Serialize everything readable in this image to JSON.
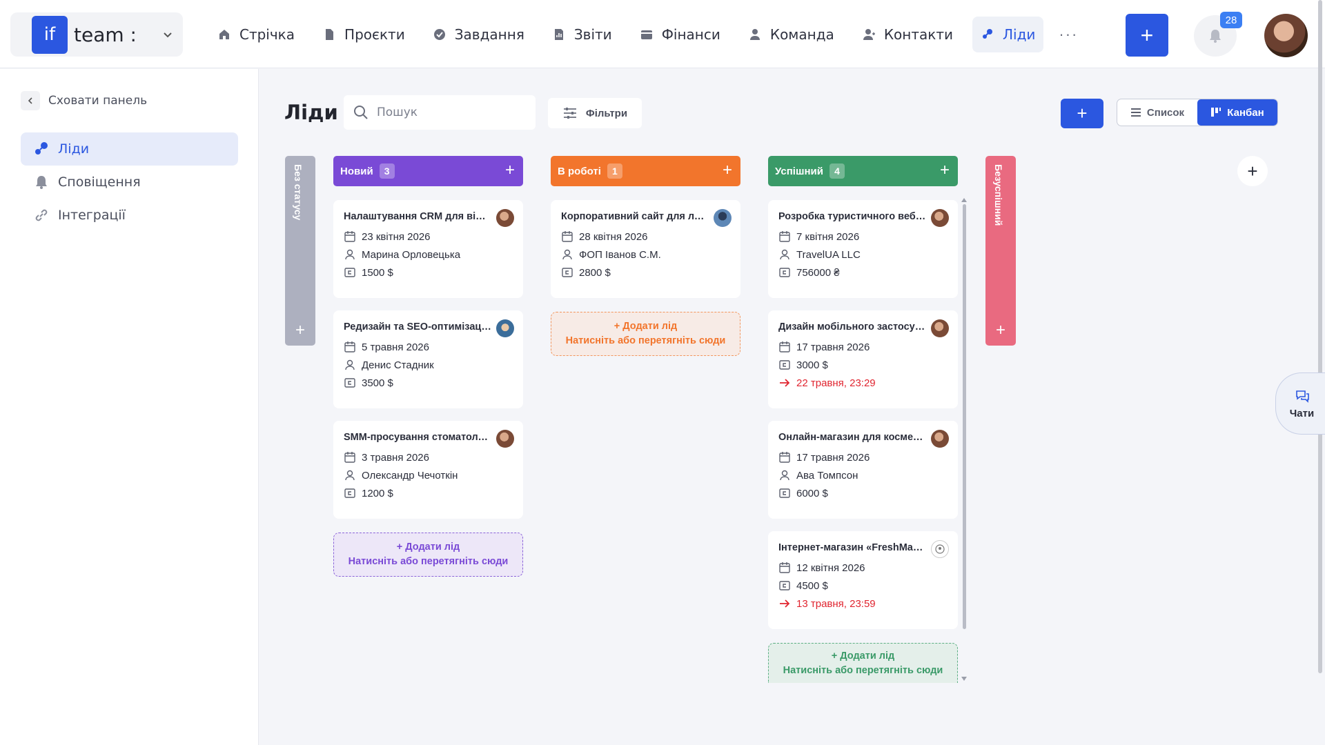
{
  "workspace": {
    "logo": "if",
    "name": "team :"
  },
  "nav": [
    {
      "label": "Стрічка",
      "icon": "home-icon"
    },
    {
      "label": "Проєкти",
      "icon": "document-icon"
    },
    {
      "label": "Завдання",
      "icon": "check-circle-icon"
    },
    {
      "label": "Звіти",
      "icon": "report-icon"
    },
    {
      "label": "Фінанси",
      "icon": "wallet-icon"
    },
    {
      "label": "Команда",
      "icon": "user-icon"
    },
    {
      "label": "Контакти",
      "icon": "contacts-icon"
    },
    {
      "label": "Ліди",
      "icon": "leads-icon"
    }
  ],
  "nav_more": "···",
  "header": {
    "add_label": "+",
    "notifications_count": "28"
  },
  "sidebar": {
    "hide_label": "Сховати панель",
    "items": [
      {
        "label": "Ліди",
        "icon": "leads-icon"
      },
      {
        "label": "Сповіщення",
        "icon": "bell-icon"
      },
      {
        "label": "Інтеграції",
        "icon": "link-icon"
      }
    ]
  },
  "main": {
    "title": "Ліди",
    "search_placeholder": "Пошук",
    "filters_label": "Фільтри",
    "add_label": "+",
    "view_list": "Список",
    "view_kanban": "Канбан"
  },
  "columns": {
    "no_status": {
      "label": "Без статусу",
      "plus": "+",
      "color": "#adb0bf"
    },
    "new": {
      "label": "Новий",
      "count": "3",
      "plus": "+",
      "color": "#7a4ad6"
    },
    "in_progress": {
      "label": "В роботі",
      "count": "1",
      "plus": "+",
      "color": "#f2752c"
    },
    "success": {
      "label": "Успішний",
      "count": "4",
      "plus": "+",
      "color": "#3a9a68"
    },
    "failed": {
      "label": "Безуспішний",
      "plus": "+",
      "color": "#e96a80"
    }
  },
  "cards": {
    "new": [
      {
        "title": "Налаштування CRM для відділу продажів",
        "date": "23 квітня 2026",
        "contact": "Марина Орловецька",
        "amount": "1500 $"
      },
      {
        "title": "Редизайн та SEO-оптимізація сайту",
        "date": "5 травня 2026",
        "contact": "Денис Стадник",
        "amount": "3500 $"
      },
      {
        "title": "SMM-просування стоматологічної клініки",
        "date": "3 травня 2026",
        "contact": "Олександр Чечоткін",
        "amount": "1200 $"
      }
    ],
    "in_progress": [
      {
        "title": "Корпоративний сайт для логістичної компанії",
        "date": "28 квітня 2026",
        "contact": "ФОП Іванов С.М.",
        "amount": "2800 $"
      }
    ],
    "success": [
      {
        "title": "Розробка туристичного веб-порталу",
        "date": "7 квітня 2026",
        "contact": "TravelUA LLC",
        "amount": "756000 ₴"
      },
      {
        "title": "Дизайн мобільного застосунку",
        "date": "17 травня 2026",
        "amount": "3000 $",
        "deadline": "22 травня, 23:29"
      },
      {
        "title": "Онлайн-магазин для косметики",
        "date": "17 травня 2026",
        "contact": "Ава Томпсон",
        "amount": "6000 $"
      },
      {
        "title": "Інтернет-магазин «FreshMarket»",
        "date": "12 квітня 2026",
        "amount": "4500 $",
        "deadline": "13 травня, 23:59"
      }
    ]
  },
  "drop": {
    "add": "+ Додати лід",
    "hint": "Натисніть або перетягніть сюди"
  },
  "chats_label": "Чати",
  "colors": {
    "accent": "#2b57e0",
    "late": "#e0242f"
  }
}
